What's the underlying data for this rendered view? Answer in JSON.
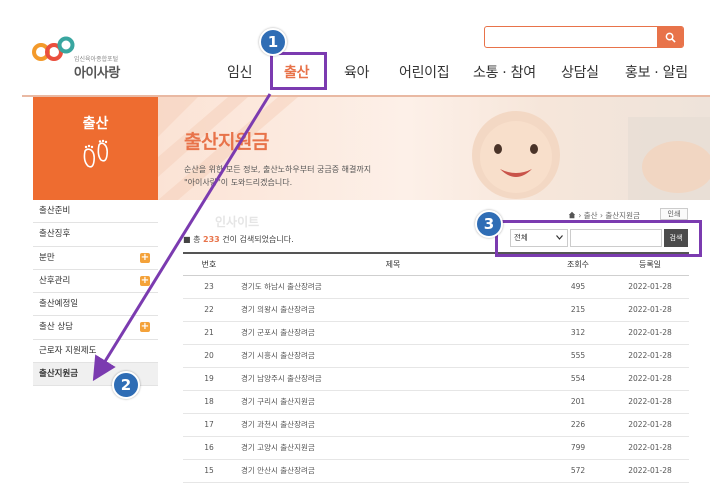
{
  "logo": {
    "subtitle": "임신육아종합포털",
    "name": "아이사랑"
  },
  "search": {
    "placeholder": ""
  },
  "gnb": {
    "items": [
      "임신",
      "출산",
      "육아",
      "어린이집",
      "소통 · 참여",
      "상담실",
      "홍보 · 알림"
    ],
    "active": 1
  },
  "banner": {
    "title": "출산지원금",
    "desc_line1": "순산을 위한 모든 정보, 출산노하우부터 궁금증 해결까지",
    "desc_line2": "\"아이사랑\"이 도와드리겠습니다."
  },
  "sidebar": {
    "title": "출산",
    "items": [
      {
        "label": "출산준비",
        "plus": false
      },
      {
        "label": "출산징후",
        "plus": false
      },
      {
        "label": "분만",
        "plus": true
      },
      {
        "label": "산후관리",
        "plus": true
      },
      {
        "label": "출산예정일",
        "plus": false
      },
      {
        "label": "출산 상담",
        "plus": true
      },
      {
        "label": "근로자 지원제도",
        "plus": false
      },
      {
        "label": "출산지원금",
        "plus": false,
        "active": true
      }
    ]
  },
  "content": {
    "watermark": "인사이트",
    "breadcrumb_sep": "›",
    "breadcrumb": [
      "출산",
      "출산지원금"
    ],
    "print_label": "인쇄",
    "count_prefix": "총",
    "count": "233",
    "count_suffix": "건이 검색되었습니다.",
    "filter_value": "전체",
    "search_btn": "검색"
  },
  "table": {
    "headers": [
      "번호",
      "제목",
      "조회수",
      "등록일"
    ],
    "rows": [
      [
        "23",
        "경기도 하남시 출산장려금",
        "495",
        "2022-01-28"
      ],
      [
        "22",
        "경기 의왕시 출산장려금",
        "215",
        "2022-01-28"
      ],
      [
        "21",
        "경기 군포시 출산장려금",
        "312",
        "2022-01-28"
      ],
      [
        "20",
        "경기 시흥시 출산장려금",
        "555",
        "2022-01-28"
      ],
      [
        "19",
        "경기 남양주시 출산장려금",
        "554",
        "2022-01-28"
      ],
      [
        "18",
        "경기 구리시 출산지원금",
        "201",
        "2022-01-28"
      ],
      [
        "17",
        "경기 과천시 출산장려금",
        "226",
        "2022-01-28"
      ],
      [
        "16",
        "경기 고양시 출산지원금",
        "799",
        "2022-01-28"
      ],
      [
        "15",
        "경기 안산시 출산장려금",
        "572",
        "2022-01-28"
      ]
    ]
  },
  "annotations": {
    "badges": [
      "1",
      "2",
      "3"
    ]
  },
  "colors": {
    "accent": "#e8734a",
    "sidebar": "#ee6c30",
    "highlight": "#7b3bb0",
    "badge": "#2f6db5"
  }
}
